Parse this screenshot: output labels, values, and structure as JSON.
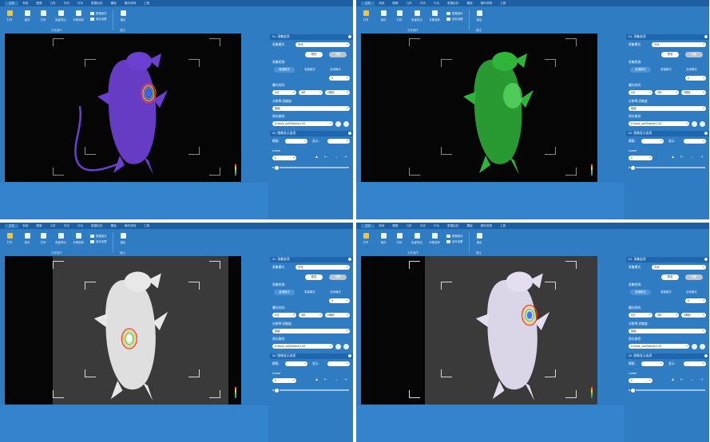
{
  "menu": [
    "文件",
    "系统",
    "图像",
    "几件",
    "冷光",
    "行为",
    "数据后处",
    "模版",
    "操作说明",
    "工具"
  ],
  "toolbar": {
    "open": "打开",
    "save": "保存",
    "print": "打印",
    "fit": "批量导出",
    "pan": "平移选择",
    "mini_1": "数据保存",
    "mini_2": "保存设置",
    "exit": "退出",
    "group_left": "文件操作",
    "group_right": "退出"
  },
  "panel": {
    "section1": "01. 采集选项",
    "mode_label": "采集模式:",
    "mode_value": "冷光",
    "btn_preview": "预览",
    "btn_capture": "采集",
    "exposure_label": "采集检测:",
    "exposure_tabs": [
      "普通模式",
      "智能模式",
      "自动曝光"
    ],
    "count_value": "0",
    "binning_label": "曝光时间:",
    "time_parts": [
      "0分",
      "0秒",
      "0毫秒"
    ],
    "gain_label": "分辨率/灵敏度:",
    "gain_value": "智能",
    "path_label": "保存路径:",
    "path_value": "D:\\work_set\\Ondmal 1.00",
    "section2": "02. 图像显示选项",
    "zoom_label": "模版:",
    "zoom_label2": "显示:",
    "lower_label": "Lower",
    "lower_value": "0"
  },
  "panels_by_quad": [
    {
      "count_value": "0"
    },
    {
      "count_value": "0"
    },
    {
      "count_value": "5"
    },
    {
      "count_value": "5"
    }
  ],
  "colors": {
    "chrome_blue": "#2f7cc3",
    "menubar_blue": "#1d5fa3",
    "mouse_purple": "#6b3fd0",
    "mouse_green": "#2fb53a",
    "mouse_white": "#e8e8e8",
    "mouse_lavender": "#e4def0"
  },
  "quads": [
    {
      "view": "bioluminescence-overlay",
      "mouse_color": "#6b3fd0",
      "bg": "dark"
    },
    {
      "view": "fluorescence",
      "mouse_color": "#2fb53a",
      "bg": "dark"
    },
    {
      "view": "photograph-with-signal",
      "mouse_color": "#e8e8e8",
      "bg": "gray"
    },
    {
      "view": "photograph-with-signal-lavender",
      "mouse_color": "#e4def0",
      "bg": "gray"
    }
  ]
}
